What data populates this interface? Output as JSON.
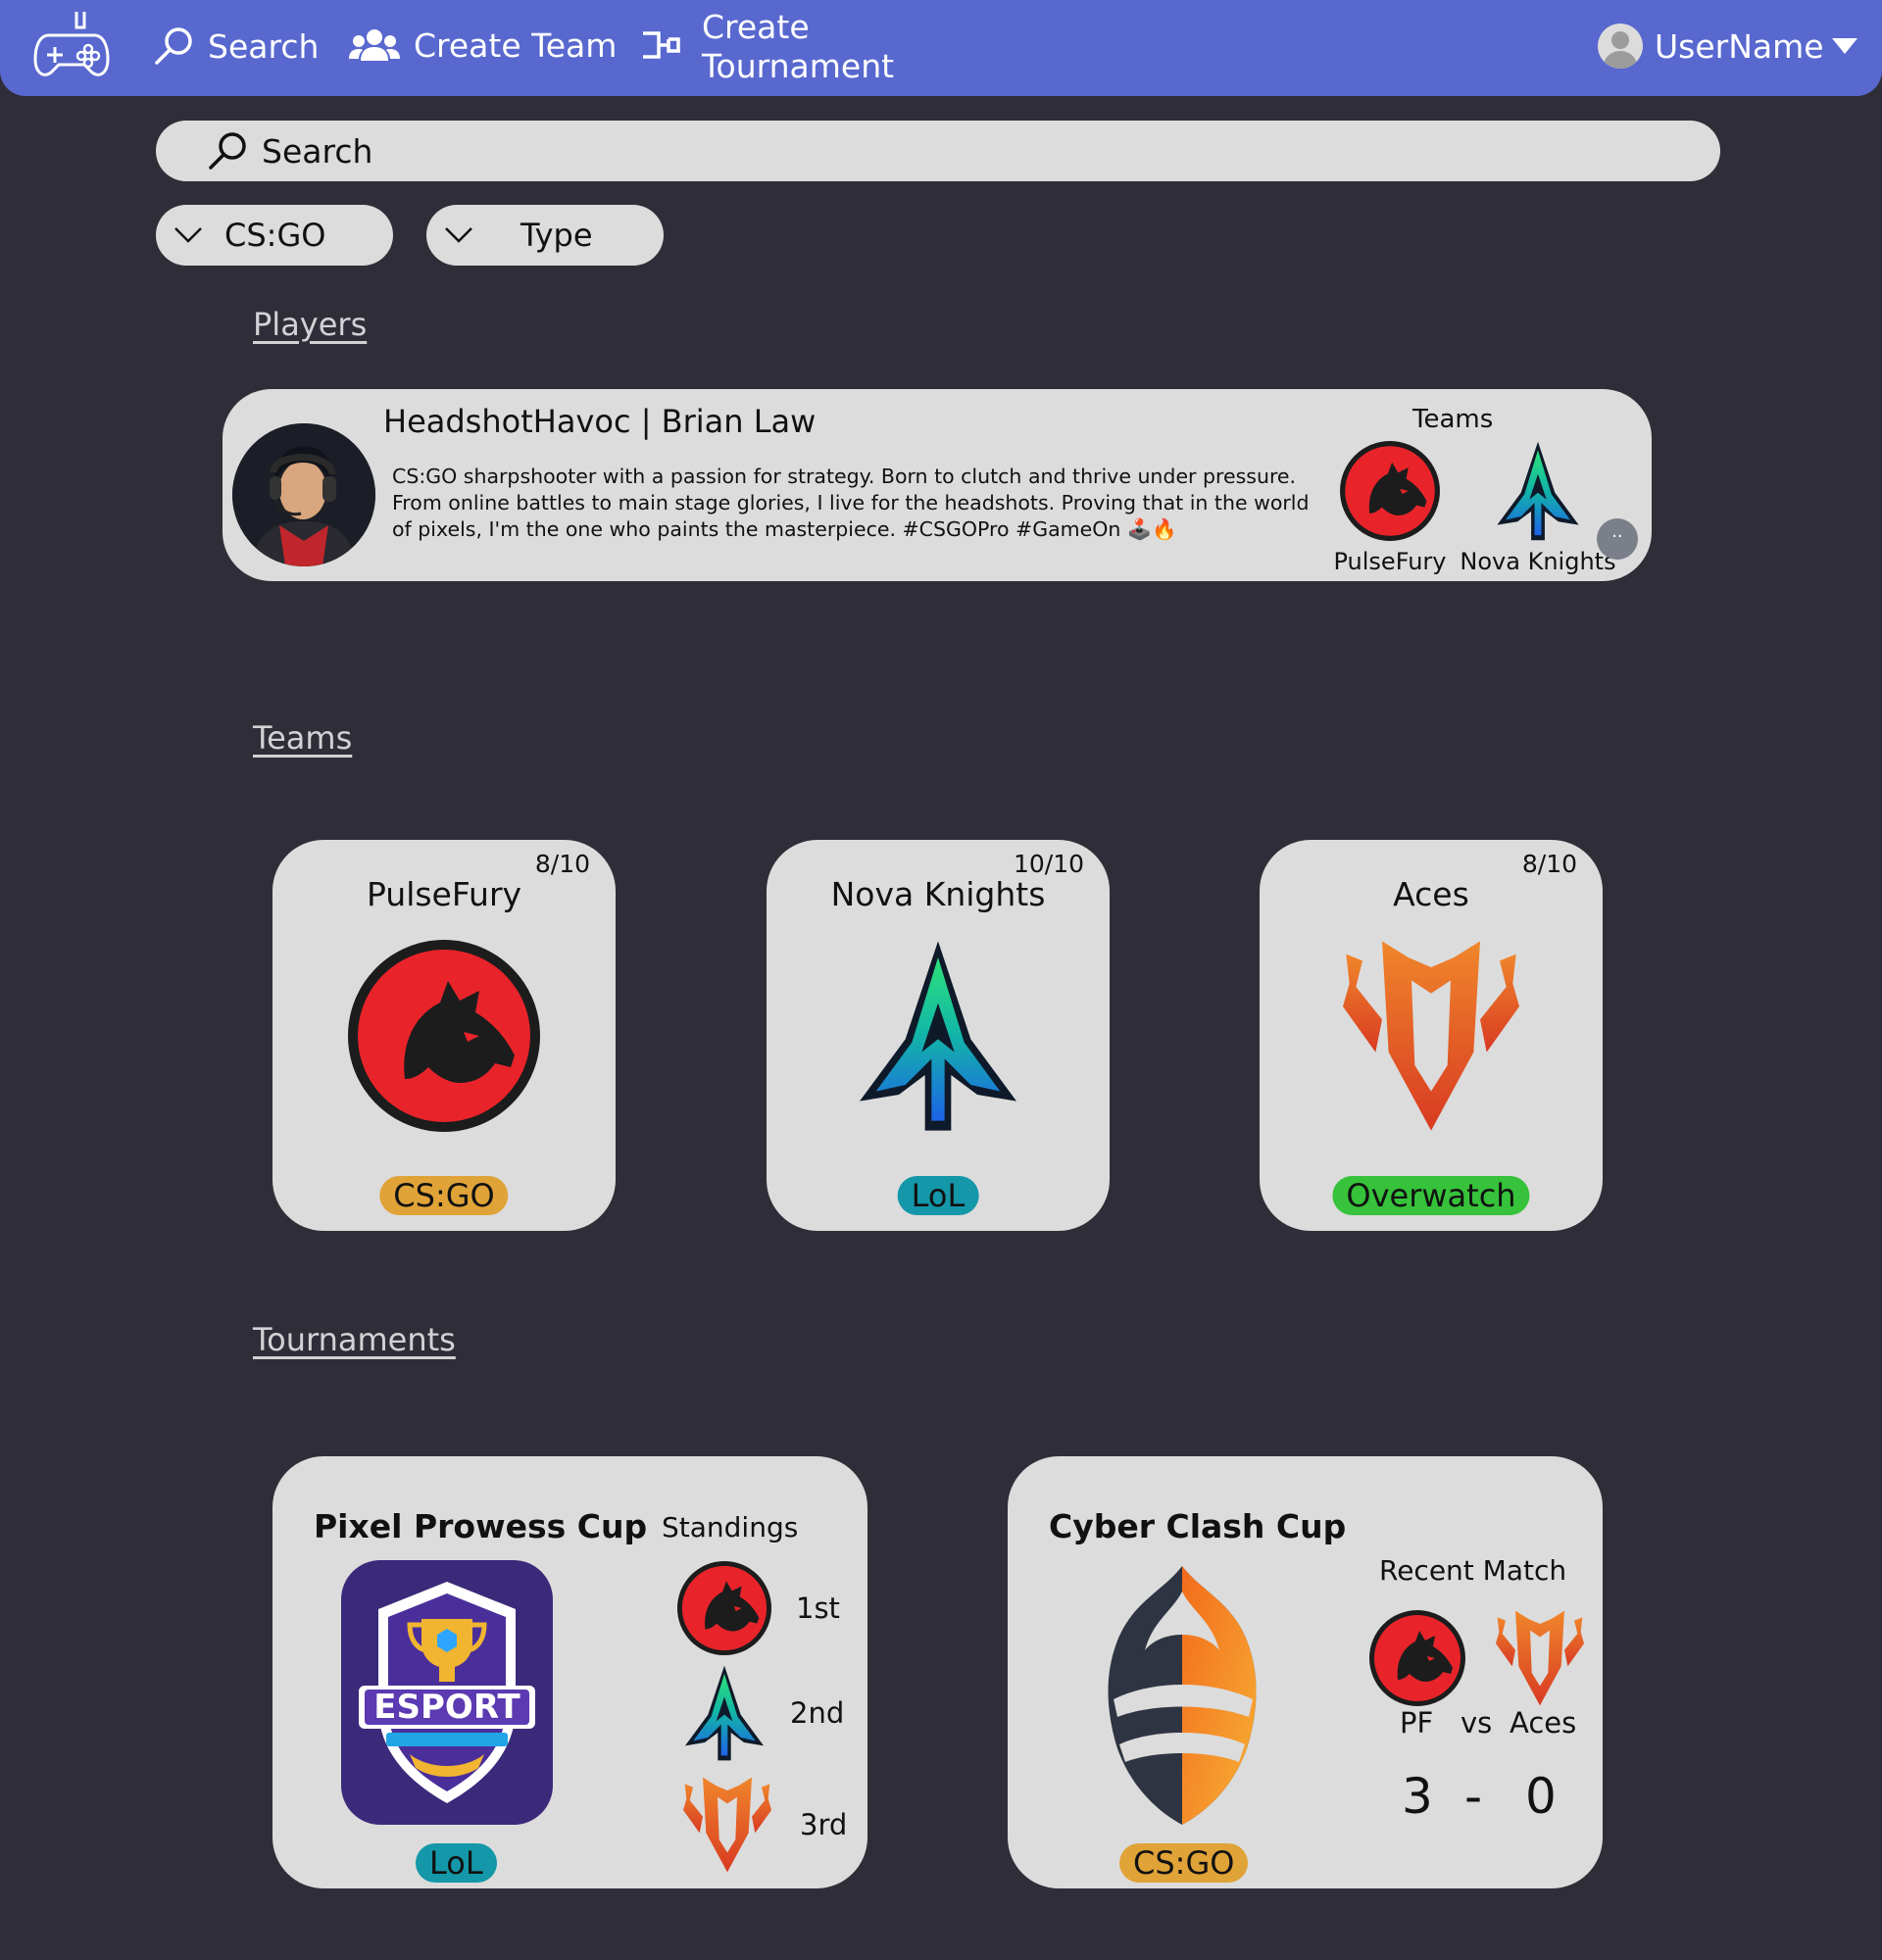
{
  "nav": {
    "search_label": "Search",
    "create_team_label": "Create Team",
    "create_tournament_label": "Create Tournament",
    "username": "UserName",
    "bg_color": "#5868cf"
  },
  "search": {
    "placeholder": "Search"
  },
  "filters": {
    "game": "CS:GO",
    "type": "Type"
  },
  "sections": {
    "players": "Players",
    "teams": "Teams",
    "tournaments": "Tournaments"
  },
  "player": {
    "name": "HeadshotHavoc | Brian Law",
    "bio": "CS:GO sharpshooter with a passion for strategy. Born to clutch and thrive under pressure. From online battles to main stage glories, I live for the headshots. Proving that in the world of pixels, I'm the one who paints the masterpiece. #CSGOPro #GameOn 🕹️🔥",
    "teams_label": "Teams",
    "teams": [
      "PulseFury",
      "Nova Knights"
    ],
    "more_label": "··"
  },
  "teams": [
    {
      "name": "PulseFury",
      "count": "8/10",
      "game": "CS:GO",
      "game_color": "#e0a338",
      "logo": "wolf-icon"
    },
    {
      "name": "Nova Knights",
      "count": "10/10",
      "game": "LoL",
      "game_color": "#1497a9",
      "logo": "arrow-icon"
    },
    {
      "name": "Aces",
      "count": "8/10",
      "game": "Overwatch",
      "game_color": "#36c23a",
      "logo": "shield-v-icon"
    }
  ],
  "tournaments": [
    {
      "name": "Pixel Prowess Cup",
      "game": "LoL",
      "standings_label": "Standings",
      "standings": [
        "1st",
        "2nd",
        "3rd"
      ]
    },
    {
      "name": "Cyber Clash Cup",
      "game": "CS:GO",
      "recent_label": "Recent Match",
      "team_a": "PF",
      "vs": "vs",
      "team_b": "Aces",
      "score_a": "3",
      "dash": "-",
      "score_b": "0"
    }
  ]
}
